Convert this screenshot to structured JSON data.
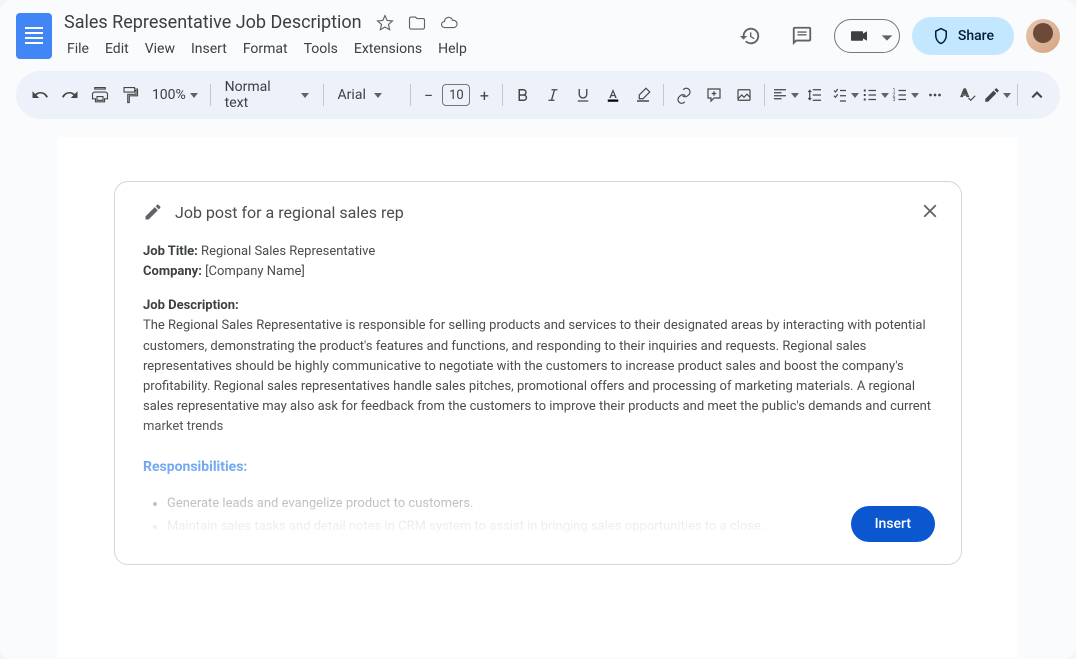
{
  "header": {
    "doc_title": "Sales Representative Job Description",
    "menu": [
      "File",
      "Edit",
      "View",
      "Insert",
      "Format",
      "Tools",
      "Extensions",
      "Help"
    ],
    "share_label": "Share"
  },
  "toolbar": {
    "zoom": "100%",
    "paragraph_style": "Normal text",
    "font_family": "Arial",
    "font_size": "10"
  },
  "prompt": {
    "title": "Job post for a regional sales rep",
    "insert_button": "Insert"
  },
  "document": {
    "job_title_label": "Job Title:",
    "job_title_value": " Regional Sales Representative",
    "company_label": "Company:",
    "company_value": " [Company Name]",
    "desc_heading": "Job Description:",
    "desc_body": "The Regional Sales Representative is responsible for selling products and services to their designated areas by interacting with potential customers, demonstrating the product's features and functions, and responding to their inquiries and requests. Regional sales representatives should be highly communicative to negotiate with the customers to increase product sales and boost the company's profitability. Regional sales representatives handle sales pitches, promotional offers and processing of marketing materials. A regional sales representative may also ask for feedback from the customers to improve their products and meet the public's demands and current market trends",
    "responsibilities_heading": "Responsibilities:",
    "bullets": [
      "Generate leads and evangelize product to customers.",
      "Maintain sales tasks and detail notes in CRM system to assist in bringing sales opportunities to a close."
    ]
  }
}
